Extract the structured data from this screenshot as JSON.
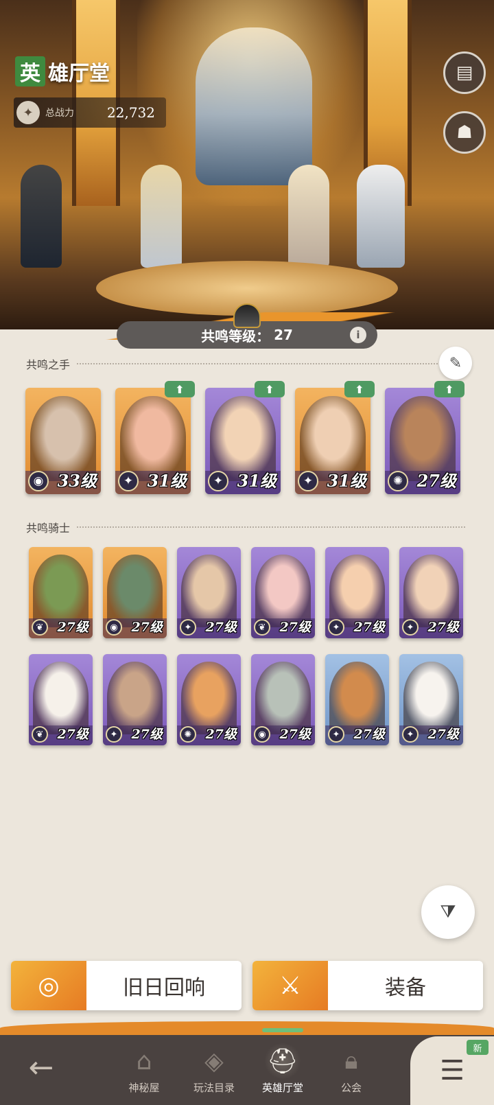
{
  "header": {
    "title_first_char": "英",
    "title_rest": "雄厅堂",
    "power_label": "总战力",
    "power_value": "22,732"
  },
  "resonance": {
    "label": "共鸣等级：",
    "level": "27",
    "info_icon": "i"
  },
  "hands": {
    "title": "共鸣之手",
    "cards": [
      {
        "level": "33级",
        "palette": "orange",
        "class_icon": "eye-icon",
        "upgrade": false
      },
      {
        "level": "31级",
        "palette": "orange",
        "class_icon": "star-icon",
        "upgrade": true
      },
      {
        "level": "31级",
        "palette": "purple",
        "class_icon": "star-icon",
        "upgrade": true
      },
      {
        "level": "31级",
        "palette": "orange",
        "class_icon": "star-icon",
        "upgrade": true
      },
      {
        "level": "27级",
        "palette": "purple",
        "class_icon": "sun-icon",
        "upgrade": true
      }
    ]
  },
  "knights": {
    "title": "共鸣骑士",
    "cards": [
      {
        "level": "27级",
        "palette": "orange",
        "class_icon": "leaf-icon"
      },
      {
        "level": "27级",
        "palette": "orange",
        "class_icon": "eye-icon"
      },
      {
        "level": "27级",
        "palette": "purple",
        "class_icon": "star-icon"
      },
      {
        "level": "27级",
        "palette": "purple",
        "class_icon": "leaf-icon"
      },
      {
        "level": "27级",
        "palette": "purple",
        "class_icon": "star-icon"
      },
      {
        "level": "27级",
        "palette": "purple",
        "class_icon": "star-icon"
      },
      {
        "level": "27级",
        "palette": "purple",
        "class_icon": "leaf-icon"
      },
      {
        "level": "27级",
        "palette": "purple",
        "class_icon": "star-icon"
      },
      {
        "level": "27级",
        "palette": "purple",
        "class_icon": "sun-icon"
      },
      {
        "level": "27级",
        "palette": "purple",
        "class_icon": "eye-icon"
      },
      {
        "level": "27级",
        "palette": "blue",
        "class_icon": "star-icon"
      },
      {
        "level": "27级",
        "palette": "blue",
        "class_icon": "star-icon"
      }
    ]
  },
  "actions": {
    "echoes_label": "旧日回响",
    "equipment_label": "装备"
  },
  "nav": {
    "items": [
      {
        "label": "神秘屋",
        "icon": "house-icon"
      },
      {
        "label": "玩法目录",
        "icon": "diamond-icon"
      },
      {
        "label": "英雄厅堂",
        "icon": "helmet-icon"
      },
      {
        "label": "公会",
        "icon": "lock-icon"
      }
    ],
    "new_badge": "新"
  },
  "colors": {
    "accent_orange": "#e9952c",
    "accent_green": "#4f9a62",
    "card_orange": "#eea24a",
    "card_purple": "#8c6bc6",
    "card_blue": "#7fa7d6"
  }
}
